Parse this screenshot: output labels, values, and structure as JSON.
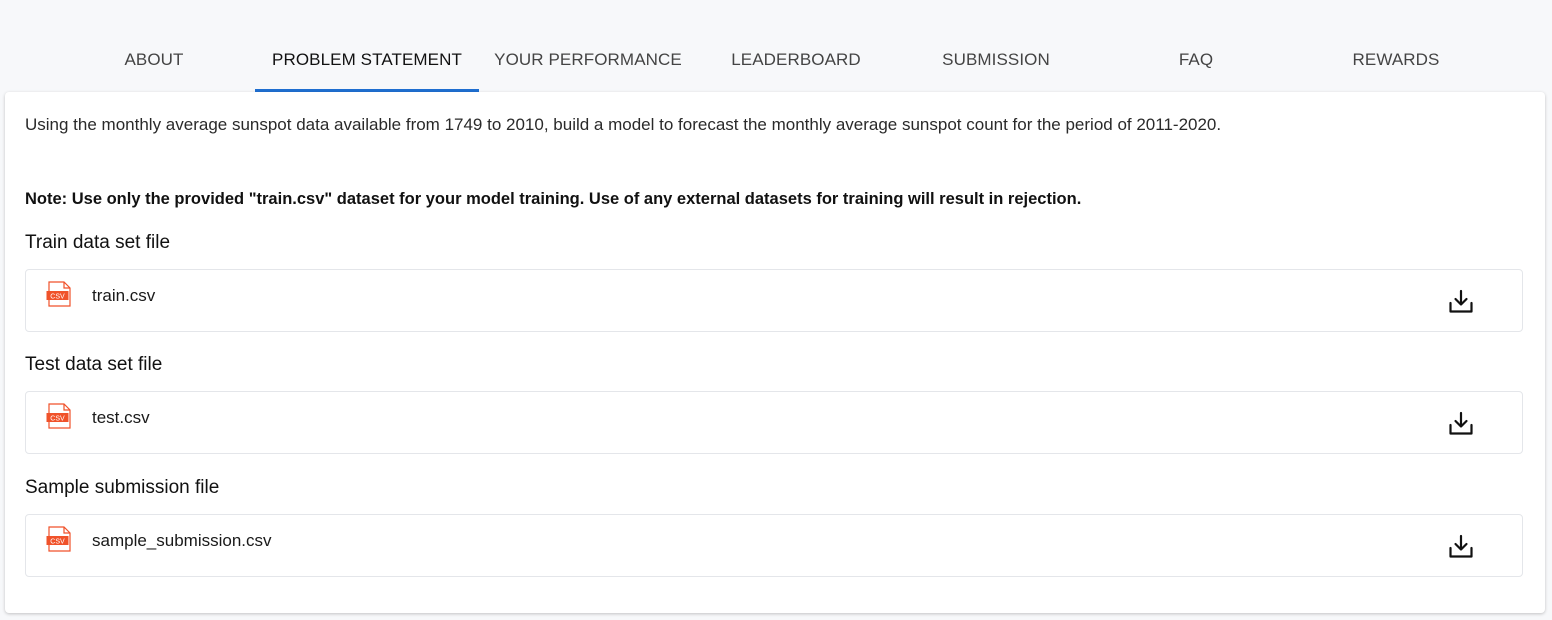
{
  "tabs": [
    {
      "label": "ABOUT",
      "active": false
    },
    {
      "label": "PROBLEM STATEMENT",
      "active": true
    },
    {
      "label": "YOUR PERFORMANCE",
      "active": false
    },
    {
      "label": "LEADERBOARD",
      "active": false
    },
    {
      "label": "SUBMISSION",
      "active": false
    },
    {
      "label": "FAQ",
      "active": false
    },
    {
      "label": "REWARDS",
      "active": false
    }
  ],
  "problem": {
    "description": "Using the monthly average sunspot data available from 1749 to 2010, build a model to forecast the monthly average sunspot count for the period of 2011-2020.",
    "note": "Note: Use only the provided \"train.csv\" dataset for your model training.  Use of any external datasets  for training will result in rejection."
  },
  "files": [
    {
      "section_title": "Train data set file",
      "file_name": "train.csv",
      "icon": "csv-file-icon",
      "action_icon": "download-icon"
    },
    {
      "section_title": "Test data set file",
      "file_name": "test.csv",
      "icon": "csv-file-icon",
      "action_icon": "download-icon"
    },
    {
      "section_title": "Sample submission file",
      "file_name": "sample_submission.csv",
      "icon": "csv-file-icon",
      "action_icon": "download-icon"
    }
  ],
  "icon_label": "CSV",
  "colors": {
    "accent": "#1f6fd1",
    "csv_icon": "#f0522a",
    "background": "#f7f8fa",
    "panel": "#ffffff"
  }
}
